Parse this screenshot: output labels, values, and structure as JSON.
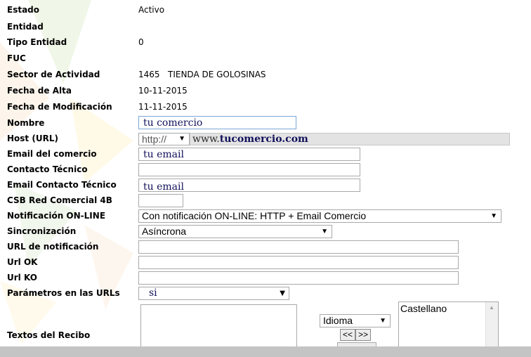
{
  "labels": {
    "estado": "Estado",
    "entidad": "Entidad",
    "tipo_entidad": "Tipo Entidad",
    "fuc": "FUC",
    "sector": "Sector de Actividad",
    "fecha_alta": "Fecha de Alta",
    "fecha_mod": "Fecha de Modificación",
    "nombre": "Nombre",
    "host": "Host (URL)",
    "email_comercio": "Email del comercio",
    "contacto_tecnico": "Contacto Técnico",
    "email_contacto": "Email Contacto Técnico",
    "csb": "CSB Red Comercial 4B",
    "notificacion": "Notificación ON-LINE",
    "sincronizacion": "Sincronización",
    "url_notificacion": "URL de notificación",
    "url_ok": "Url OK",
    "url_ko": "Url KO",
    "parametros": "Parámetros en las URLs",
    "textos_recibo": "Textos del Recibo"
  },
  "values": {
    "estado": "Activo",
    "tipo_entidad": "0",
    "sector_code": "1465",
    "sector_name": "TIENDA DE GOLOSINAS",
    "fecha_alta": "10-11-2015",
    "fecha_mod": "11-11-2015"
  },
  "fields": {
    "nombre": "tu comercio",
    "host_protocol": "http://",
    "host_prefix": "www.",
    "host_domain": "tucomercio.com",
    "email_comercio": "tu email",
    "contacto_tecnico": "",
    "email_contacto": "tu email",
    "csb": "",
    "notificacion": "Con notificación ON-LINE: HTTP + Email Comercio",
    "sincronizacion": "Asíncrona",
    "url_notificacion": "",
    "url_ok": "",
    "url_ko": "",
    "parametros": "si"
  },
  "recibo": {
    "idioma_select": "Idioma",
    "move_button": "<<|>>",
    "move_left": "<<",
    "move_right": ">>",
    "languages": [
      "Castellano"
    ]
  },
  "colors": {
    "text_input": "#10105a",
    "prefix_bg": "#e3e3e3",
    "bottom_bar": "#c4c4c4"
  }
}
